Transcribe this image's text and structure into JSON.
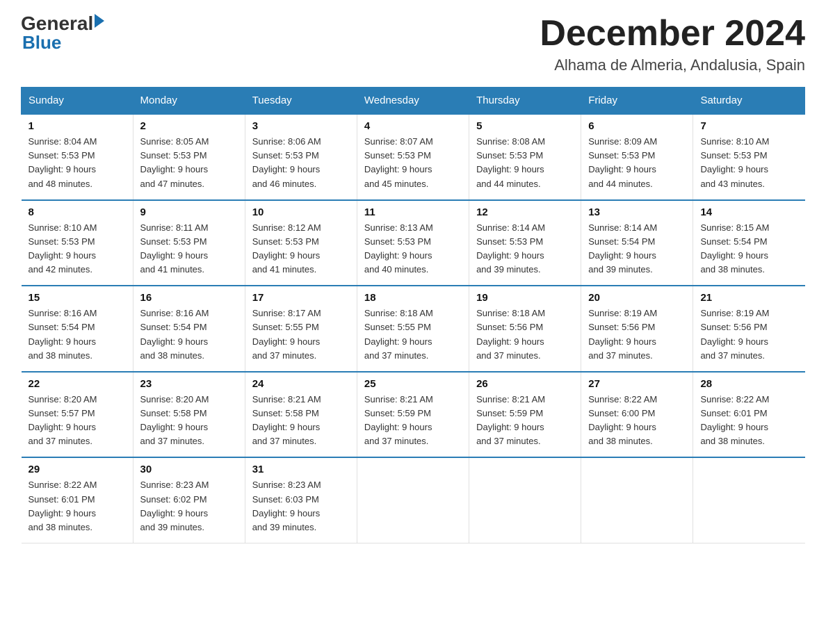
{
  "header": {
    "logo_general": "General",
    "logo_blue": "Blue",
    "title": "December 2024",
    "subtitle": "Alhama de Almeria, Andalusia, Spain"
  },
  "days_of_week": [
    "Sunday",
    "Monday",
    "Tuesday",
    "Wednesday",
    "Thursday",
    "Friday",
    "Saturday"
  ],
  "weeks": [
    [
      {
        "num": "1",
        "sunrise": "8:04 AM",
        "sunset": "5:53 PM",
        "daylight": "9 hours and 48 minutes."
      },
      {
        "num": "2",
        "sunrise": "8:05 AM",
        "sunset": "5:53 PM",
        "daylight": "9 hours and 47 minutes."
      },
      {
        "num": "3",
        "sunrise": "8:06 AM",
        "sunset": "5:53 PM",
        "daylight": "9 hours and 46 minutes."
      },
      {
        "num": "4",
        "sunrise": "8:07 AM",
        "sunset": "5:53 PM",
        "daylight": "9 hours and 45 minutes."
      },
      {
        "num": "5",
        "sunrise": "8:08 AM",
        "sunset": "5:53 PM",
        "daylight": "9 hours and 44 minutes."
      },
      {
        "num": "6",
        "sunrise": "8:09 AM",
        "sunset": "5:53 PM",
        "daylight": "9 hours and 44 minutes."
      },
      {
        "num": "7",
        "sunrise": "8:10 AM",
        "sunset": "5:53 PM",
        "daylight": "9 hours and 43 minutes."
      }
    ],
    [
      {
        "num": "8",
        "sunrise": "8:10 AM",
        "sunset": "5:53 PM",
        "daylight": "9 hours and 42 minutes."
      },
      {
        "num": "9",
        "sunrise": "8:11 AM",
        "sunset": "5:53 PM",
        "daylight": "9 hours and 41 minutes."
      },
      {
        "num": "10",
        "sunrise": "8:12 AM",
        "sunset": "5:53 PM",
        "daylight": "9 hours and 41 minutes."
      },
      {
        "num": "11",
        "sunrise": "8:13 AM",
        "sunset": "5:53 PM",
        "daylight": "9 hours and 40 minutes."
      },
      {
        "num": "12",
        "sunrise": "8:14 AM",
        "sunset": "5:53 PM",
        "daylight": "9 hours and 39 minutes."
      },
      {
        "num": "13",
        "sunrise": "8:14 AM",
        "sunset": "5:54 PM",
        "daylight": "9 hours and 39 minutes."
      },
      {
        "num": "14",
        "sunrise": "8:15 AM",
        "sunset": "5:54 PM",
        "daylight": "9 hours and 38 minutes."
      }
    ],
    [
      {
        "num": "15",
        "sunrise": "8:16 AM",
        "sunset": "5:54 PM",
        "daylight": "9 hours and 38 minutes."
      },
      {
        "num": "16",
        "sunrise": "8:16 AM",
        "sunset": "5:54 PM",
        "daylight": "9 hours and 38 minutes."
      },
      {
        "num": "17",
        "sunrise": "8:17 AM",
        "sunset": "5:55 PM",
        "daylight": "9 hours and 37 minutes."
      },
      {
        "num": "18",
        "sunrise": "8:18 AM",
        "sunset": "5:55 PM",
        "daylight": "9 hours and 37 minutes."
      },
      {
        "num": "19",
        "sunrise": "8:18 AM",
        "sunset": "5:56 PM",
        "daylight": "9 hours and 37 minutes."
      },
      {
        "num": "20",
        "sunrise": "8:19 AM",
        "sunset": "5:56 PM",
        "daylight": "9 hours and 37 minutes."
      },
      {
        "num": "21",
        "sunrise": "8:19 AM",
        "sunset": "5:56 PM",
        "daylight": "9 hours and 37 minutes."
      }
    ],
    [
      {
        "num": "22",
        "sunrise": "8:20 AM",
        "sunset": "5:57 PM",
        "daylight": "9 hours and 37 minutes."
      },
      {
        "num": "23",
        "sunrise": "8:20 AM",
        "sunset": "5:58 PM",
        "daylight": "9 hours and 37 minutes."
      },
      {
        "num": "24",
        "sunrise": "8:21 AM",
        "sunset": "5:58 PM",
        "daylight": "9 hours and 37 minutes."
      },
      {
        "num": "25",
        "sunrise": "8:21 AM",
        "sunset": "5:59 PM",
        "daylight": "9 hours and 37 minutes."
      },
      {
        "num": "26",
        "sunrise": "8:21 AM",
        "sunset": "5:59 PM",
        "daylight": "9 hours and 37 minutes."
      },
      {
        "num": "27",
        "sunrise": "8:22 AM",
        "sunset": "6:00 PM",
        "daylight": "9 hours and 38 minutes."
      },
      {
        "num": "28",
        "sunrise": "8:22 AM",
        "sunset": "6:01 PM",
        "daylight": "9 hours and 38 minutes."
      }
    ],
    [
      {
        "num": "29",
        "sunrise": "8:22 AM",
        "sunset": "6:01 PM",
        "daylight": "9 hours and 38 minutes."
      },
      {
        "num": "30",
        "sunrise": "8:23 AM",
        "sunset": "6:02 PM",
        "daylight": "9 hours and 39 minutes."
      },
      {
        "num": "31",
        "sunrise": "8:23 AM",
        "sunset": "6:03 PM",
        "daylight": "9 hours and 39 minutes."
      },
      null,
      null,
      null,
      null
    ]
  ],
  "labels": {
    "sunrise": "Sunrise:",
    "sunset": "Sunset:",
    "daylight": "Daylight:"
  }
}
